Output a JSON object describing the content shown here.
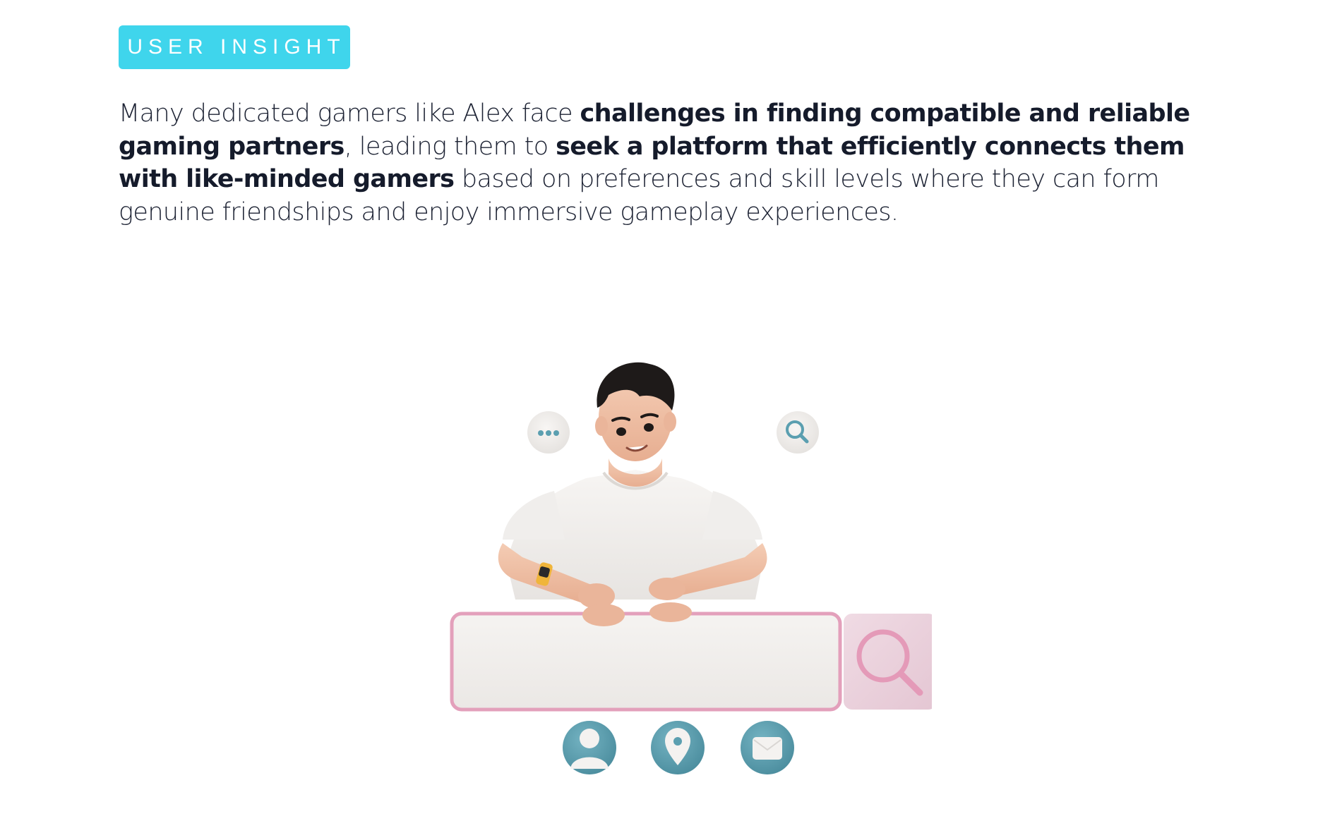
{
  "badge": {
    "label": "USER INSIGHT",
    "color": "#3fd5ec"
  },
  "insight": {
    "segments": [
      {
        "text": "Many dedicated gamers like Alex face ",
        "bold": false
      },
      {
        "text": "challenges in finding compatible and reliable gaming partners",
        "bold": true
      },
      {
        "text": ", leading them to ",
        "bold": false
      },
      {
        "text": "seek a platform that efficiently connects them with like-minded gamers",
        "bold": true
      },
      {
        "text": " based on preferences and skill levels where they can form genuine friendships and enjoy immersive gameplay experiences.",
        "bold": false
      }
    ]
  },
  "illustration": {
    "bubble_left_icon": "more-dots-icon",
    "bubble_right_icon": "search-icon",
    "search_button_icon": "search-icon",
    "bottom_icons": [
      "user-icon",
      "location-pin-icon",
      "mail-icon"
    ],
    "colors": {
      "teal": "#5b9fb0",
      "pink": "#e9a7c0",
      "search_box": "#f1efed",
      "shirt": "#f3f1ef",
      "skin": "#efbfa3",
      "hair": "#1e1a19"
    }
  }
}
